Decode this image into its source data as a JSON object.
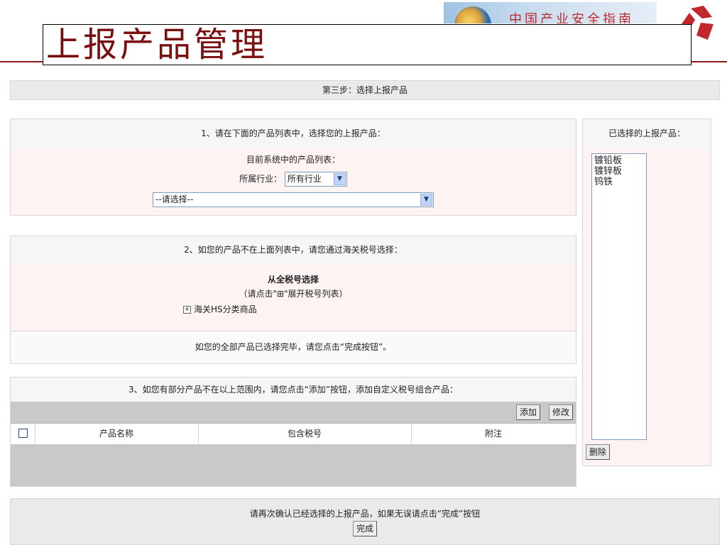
{
  "banner": {
    "text": "中国产业安全指南",
    "icon": "globe-icon"
  },
  "logo": {
    "icon": "company-logo-icon"
  },
  "page_title": "上报产品管理",
  "step": {
    "label": "第三步：选择上报产品"
  },
  "section1": {
    "heading": "1、请在下面的产品列表中，选择您的上报产品：",
    "list_title": "目前系统中的产品列表：",
    "industry_label": "所属行业：",
    "industry_value": "所有行业",
    "product_select_value": "--请选择--"
  },
  "section2": {
    "heading": "2、如您的产品不在上面列表中，请您通过海关税号选择：",
    "tariff_title": "从全税号选择",
    "tariff_hint": "（请点击\"⊞\"展开税号列表）",
    "tree_item": "海关HS分类商品",
    "done_hint": "如您的全部产品已选择完毕，请您点击“完成按钮”。"
  },
  "section3": {
    "heading": "3、如您有部分产品不在以上范围内，请您点击“添加”按钮，添加自定义税号组合产品：",
    "add_label": "添加",
    "edit_label": "修改",
    "columns": [
      "产品名称",
      "包含税号",
      "附注"
    ]
  },
  "selected": {
    "heading": "已选择的上报产品：",
    "items": [
      "镀铅板",
      "镀锌板",
      "钨铁"
    ],
    "delete_label": "删除"
  },
  "confirm": {
    "text": "请再次确认已经选择的上报产品，如果无误请点击“完成”按钮",
    "finish_label": "完成"
  },
  "colors": {
    "title_red": "#7a0f0f",
    "pink_bg": "#fdf3f3",
    "gray_bar": "#c9c9c9"
  }
}
